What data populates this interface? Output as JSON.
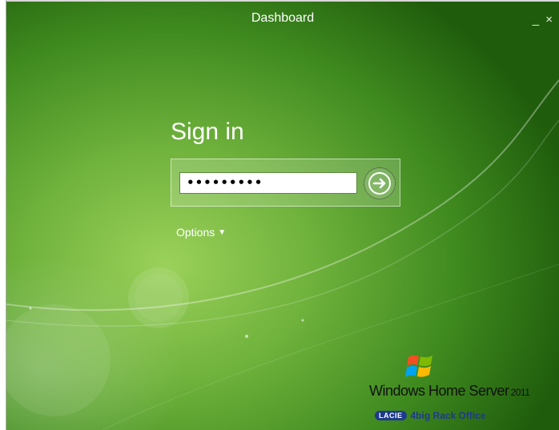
{
  "window": {
    "title": "Dashboard",
    "controls": {
      "minimize": "_",
      "close": "×"
    }
  },
  "signin": {
    "heading": "Sign in",
    "password_value": "•••••••••",
    "go_icon": "arrow-right-circle-icon",
    "options_label": "Options"
  },
  "branding": {
    "product": "Windows Home Server",
    "year": "2011",
    "flag_icon": "windows-flag-icon",
    "vendor_logo": "LACIE",
    "vendor_product": "4big Rack Office"
  },
  "colors": {
    "background_light": "#9bd15a",
    "background_dark": "#1f5c0c",
    "vendor_blue": "#1e3a8c"
  }
}
